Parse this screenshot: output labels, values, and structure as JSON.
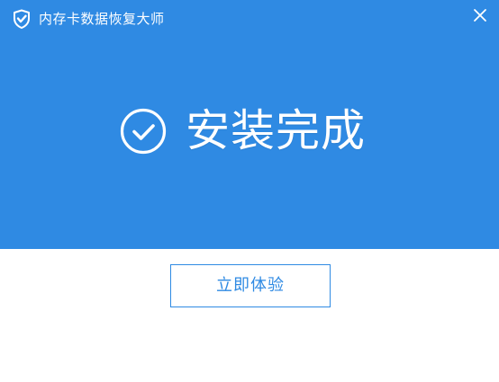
{
  "window": {
    "title": "内存卡数据恢复大师",
    "close_icon": "close-icon",
    "logo_icon": "shield-check-logo-icon"
  },
  "status": {
    "message": "安装完成",
    "icon": "check-circle-icon"
  },
  "actions": {
    "primary_label": "立即体验"
  },
  "colors": {
    "accent": "#2f8ae3",
    "header_bg": "#2f8ae3",
    "text_on_accent": "#ffffff",
    "page_bg": "#ffffff"
  }
}
